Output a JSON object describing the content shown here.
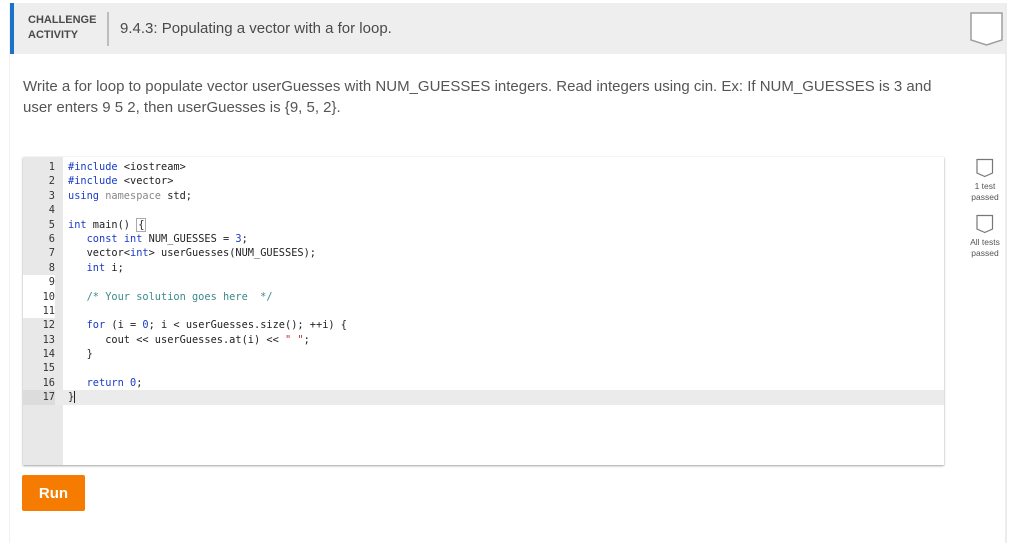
{
  "header": {
    "badge_line1": "CHALLENGE",
    "badge_line2": "ACTIVITY",
    "title": "9.4.3: Populating a vector with a for loop.",
    "completion_icon": "empty-shield-badge"
  },
  "prompt": {
    "text": "Write a for loop to populate vector userGuesses with NUM_GUESSES integers. Read integers using cin. Ex: If NUM_GUESSES is 3 and user enters 9 5 2, then userGuesses is {9, 5, 2}."
  },
  "editor": {
    "lines": [
      {
        "n": "1",
        "code": "#include <iostream>"
      },
      {
        "n": "2",
        "code": "#include <vector>"
      },
      {
        "n": "3",
        "code": "using namespace std;"
      },
      {
        "n": "4",
        "code": ""
      },
      {
        "n": "5",
        "code": "int main() {"
      },
      {
        "n": "6",
        "code": "   const int NUM_GUESSES = 3;"
      },
      {
        "n": "7",
        "code": "   vector<int> userGuesses(NUM_GUESSES);"
      },
      {
        "n": "8",
        "code": "   int i;"
      },
      {
        "n": "9",
        "code": ""
      },
      {
        "n": "10",
        "code": "   /* Your solution goes here  */"
      },
      {
        "n": "11",
        "code": ""
      },
      {
        "n": "12",
        "code": "   for (i = 0; i < userGuesses.size(); ++i) {"
      },
      {
        "n": "13",
        "code": "      cout << userGuesses.at(i) << \" \";"
      },
      {
        "n": "14",
        "code": "   }"
      },
      {
        "n": "15",
        "code": ""
      },
      {
        "n": "16",
        "code": "   return 0;"
      },
      {
        "n": "17",
        "code": "}"
      }
    ]
  },
  "tests": [
    {
      "label_line1": "1 test",
      "label_line2": "passed",
      "icon": "empty-shield-badge"
    },
    {
      "label_line1": "All tests",
      "label_line2": "passed",
      "icon": "empty-shield-badge"
    }
  ],
  "run_button": {
    "label": "Run"
  },
  "colors": {
    "accent_blue": "#1a73c8",
    "run_orange": "#f57c00"
  }
}
